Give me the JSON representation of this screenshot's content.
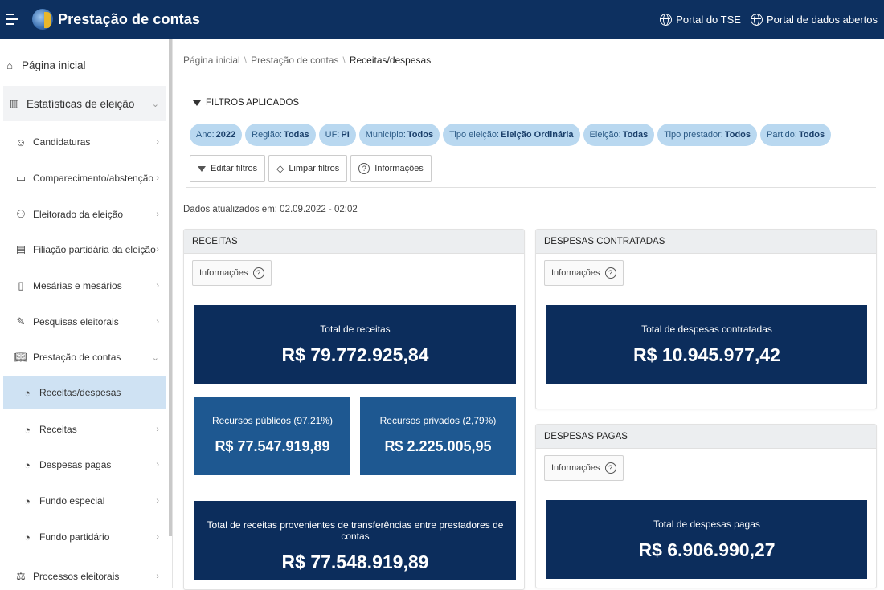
{
  "header": {
    "title": "Prestação de contas",
    "links": [
      "Portal do TSE",
      "Portal de dados abertos"
    ]
  },
  "sidebar": {
    "home": "Página inicial",
    "stats": "Estatísticas de eleição",
    "items": [
      {
        "label": "Candidaturas",
        "icon": "user-icon"
      },
      {
        "label": "Comparecimento/abstenção",
        "icon": "calendar-icon"
      },
      {
        "label": "Eleitorado da eleição",
        "icon": "users-icon"
      },
      {
        "label": "Filiação partidária da eleição",
        "icon": "id-card-icon"
      },
      {
        "label": "Mesárias e mesários",
        "icon": "badge-icon"
      },
      {
        "label": "Pesquisas eleitorais",
        "icon": "edit-icon"
      },
      {
        "label": "Prestação de contas",
        "icon": "book-icon"
      }
    ],
    "sub_items": [
      {
        "label": "Receitas/despesas"
      },
      {
        "label": "Receitas"
      },
      {
        "label": "Despesas pagas"
      },
      {
        "label": "Fundo especial"
      },
      {
        "label": "Fundo partidário"
      }
    ],
    "processes": "Processos eleitorais"
  },
  "breadcrumb": {
    "home": "Página inicial",
    "section": "Prestação de contas",
    "current": "Receitas/despesas"
  },
  "filters": {
    "title": "FILTROS APLICADOS",
    "chips": [
      {
        "key": "Ano:",
        "value": "2022"
      },
      {
        "key": "Região:",
        "value": "Todas"
      },
      {
        "key": "UF:",
        "value": "PI"
      },
      {
        "key": "Município:",
        "value": "Todos"
      },
      {
        "key": "Tipo eleição:",
        "value": "Eleição Ordinária"
      },
      {
        "key": "Eleição:",
        "value": "Todas"
      },
      {
        "key": "Tipo prestador:",
        "value": "Todos"
      },
      {
        "key": "Partido:",
        "value": "Todos"
      }
    ],
    "edit": "Editar filtros",
    "clear": "Limpar filtros",
    "info": "Informações"
  },
  "updated": "Dados atualizados em: 02.09.2022 - 02:02",
  "receitas": {
    "title": "RECEITAS",
    "info": "Informações",
    "total_label": "Total de receitas",
    "total_value": "R$ 79.772.925,84",
    "public_label": "Recursos públicos (97,21%)",
    "public_value": "R$ 77.547.919,89",
    "private_label": "Recursos privados (2,79%)",
    "private_value": "R$ 2.225.005,95",
    "transfer_label": "Total de receitas provenientes de transferências entre prestadores de contas",
    "transfer_value": "R$ 77.548.919,89"
  },
  "contratadas": {
    "title": "DESPESAS CONTRATADAS",
    "info": "Informações",
    "total_label": "Total de despesas contratadas",
    "total_value": "R$ 10.945.977,42"
  },
  "pagas": {
    "title": "DESPESAS PAGAS",
    "info": "Informações",
    "total_label": "Total de despesas pagas",
    "total_value": "R$ 6.906.990,27"
  },
  "colors": {
    "header_bg": "#0d3060",
    "card_dark": "#0c2d5c",
    "card_mid": "#1e5891",
    "chip_bg": "#b9d8f0",
    "active_nav": "#cfe2f3"
  }
}
